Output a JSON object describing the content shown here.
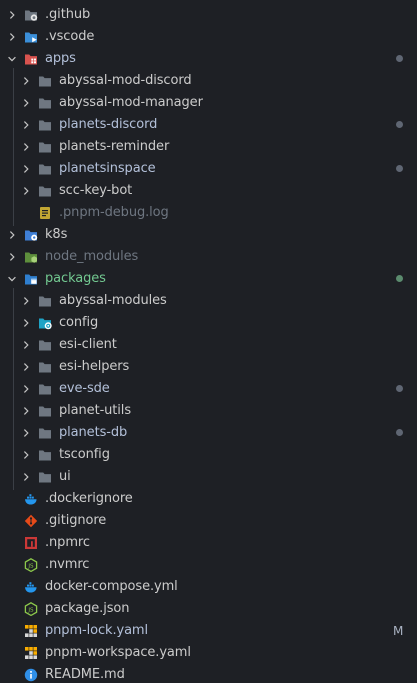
{
  "colors": {
    "default_text": "#cccccc",
    "ignored_text": "#6e7681",
    "added_text": "#73c991",
    "modified_text": "#b3c0d9",
    "badge_text": "#a9b2c2"
  },
  "explorer": {
    "items": [
      {
        "label": ".github",
        "depth": 0,
        "kind": "folder",
        "expanded": false,
        "icon": "github-folder-icon",
        "color": "default_text"
      },
      {
        "label": ".vscode",
        "depth": 0,
        "kind": "folder",
        "expanded": false,
        "icon": "vscode-folder-icon",
        "color": "default_text"
      },
      {
        "label": "apps",
        "depth": 0,
        "kind": "folder",
        "expanded": true,
        "icon": "apps-folder-icon",
        "color": "modified_text",
        "dot": "#5f6673"
      },
      {
        "label": "abyssal-mod-discord",
        "depth": 1,
        "kind": "folder",
        "expanded": false,
        "icon": "folder-icon",
        "color": "default_text"
      },
      {
        "label": "abyssal-mod-manager",
        "depth": 1,
        "kind": "folder",
        "expanded": false,
        "icon": "folder-icon",
        "color": "default_text"
      },
      {
        "label": "planets-discord",
        "depth": 1,
        "kind": "folder",
        "expanded": false,
        "icon": "folder-icon",
        "color": "modified_text",
        "dot": "#5f6673"
      },
      {
        "label": "planets-reminder",
        "depth": 1,
        "kind": "folder",
        "expanded": false,
        "icon": "folder-icon",
        "color": "default_text"
      },
      {
        "label": "planetsinspace",
        "depth": 1,
        "kind": "folder",
        "expanded": false,
        "icon": "folder-icon",
        "color": "modified_text",
        "dot": "#5f6673"
      },
      {
        "label": "scc-key-bot",
        "depth": 1,
        "kind": "folder",
        "expanded": false,
        "icon": "folder-icon",
        "color": "default_text"
      },
      {
        "label": ".pnpm-debug.log",
        "depth": 1,
        "kind": "file",
        "icon": "log-file-icon",
        "color": "ignored_text"
      },
      {
        "label": "k8s",
        "depth": 0,
        "kind": "folder",
        "expanded": false,
        "icon": "k8s-folder-icon",
        "color": "default_text"
      },
      {
        "label": "node_modules",
        "depth": 0,
        "kind": "folder",
        "expanded": false,
        "icon": "node-folder-icon",
        "color": "ignored_text"
      },
      {
        "label": "packages",
        "depth": 0,
        "kind": "folder",
        "expanded": true,
        "icon": "packages-folder-icon",
        "color": "added_text",
        "dot": "#5b8b6e"
      },
      {
        "label": "abyssal-modules",
        "depth": 1,
        "kind": "folder",
        "expanded": false,
        "icon": "folder-icon",
        "color": "default_text"
      },
      {
        "label": "config",
        "depth": 1,
        "kind": "folder",
        "expanded": false,
        "icon": "config-folder-icon",
        "color": "default_text"
      },
      {
        "label": "esi-client",
        "depth": 1,
        "kind": "folder",
        "expanded": false,
        "icon": "folder-icon",
        "color": "default_text"
      },
      {
        "label": "esi-helpers",
        "depth": 1,
        "kind": "folder",
        "expanded": false,
        "icon": "folder-icon",
        "color": "default_text"
      },
      {
        "label": "eve-sde",
        "depth": 1,
        "kind": "folder",
        "expanded": false,
        "icon": "folder-icon",
        "color": "modified_text",
        "dot": "#5f6673"
      },
      {
        "label": "planet-utils",
        "depth": 1,
        "kind": "folder",
        "expanded": false,
        "icon": "folder-icon",
        "color": "default_text"
      },
      {
        "label": "planets-db",
        "depth": 1,
        "kind": "folder",
        "expanded": false,
        "icon": "folder-icon",
        "color": "modified_text",
        "dot": "#5f6673"
      },
      {
        "label": "tsconfig",
        "depth": 1,
        "kind": "folder",
        "expanded": false,
        "icon": "folder-icon",
        "color": "default_text"
      },
      {
        "label": "ui",
        "depth": 1,
        "kind": "folder",
        "expanded": false,
        "icon": "folder-icon",
        "color": "default_text"
      },
      {
        "label": ".dockerignore",
        "depth": 0,
        "kind": "file",
        "icon": "docker-icon",
        "color": "default_text"
      },
      {
        "label": ".gitignore",
        "depth": 0,
        "kind": "file",
        "icon": "git-icon",
        "color": "default_text"
      },
      {
        "label": ".npmrc",
        "depth": 0,
        "kind": "file",
        "icon": "npm-icon",
        "color": "default_text"
      },
      {
        "label": ".nvmrc",
        "depth": 0,
        "kind": "file",
        "icon": "nodejs-icon",
        "color": "default_text"
      },
      {
        "label": "docker-compose.yml",
        "depth": 0,
        "kind": "file",
        "icon": "docker-icon",
        "color": "default_text"
      },
      {
        "label": "package.json",
        "depth": 0,
        "kind": "file",
        "icon": "nodejs-icon",
        "color": "default_text"
      },
      {
        "label": "pnpm-lock.yaml",
        "depth": 0,
        "kind": "file",
        "icon": "pnpm-icon",
        "color": "modified_text",
        "badge": "M"
      },
      {
        "label": "pnpm-workspace.yaml",
        "depth": 0,
        "kind": "file",
        "icon": "pnpm-icon",
        "color": "default_text"
      },
      {
        "label": "README.md",
        "depth": 0,
        "kind": "file",
        "icon": "info-icon",
        "color": "default_text"
      }
    ]
  }
}
